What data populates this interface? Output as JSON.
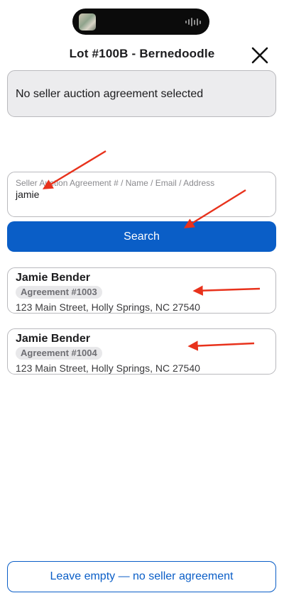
{
  "header": {
    "title": "Lot #100B - Bernedoodle",
    "close_icon": "close-icon"
  },
  "selection": {
    "text": "No seller auction agreement selected"
  },
  "search": {
    "label": "Seller Auction Agreement # / Name / Email / Address",
    "value": "jamie",
    "button_label": "Search"
  },
  "results": [
    {
      "name": "Jamie Bender",
      "agreement": "Agreement #1003",
      "address": "123 Main Street, Holly Springs, NC 27540"
    },
    {
      "name": "Jamie Bender",
      "agreement": "Agreement #1004",
      "address": "123 Main Street, Holly Springs, NC 27540"
    }
  ],
  "footer": {
    "leave_empty_label": "Leave empty — no seller agreement"
  },
  "colors": {
    "accent": "#0a5ec7",
    "annotation_arrow": "#e8321c",
    "box_fill": "#ececee",
    "border": "#b9b9bd"
  }
}
